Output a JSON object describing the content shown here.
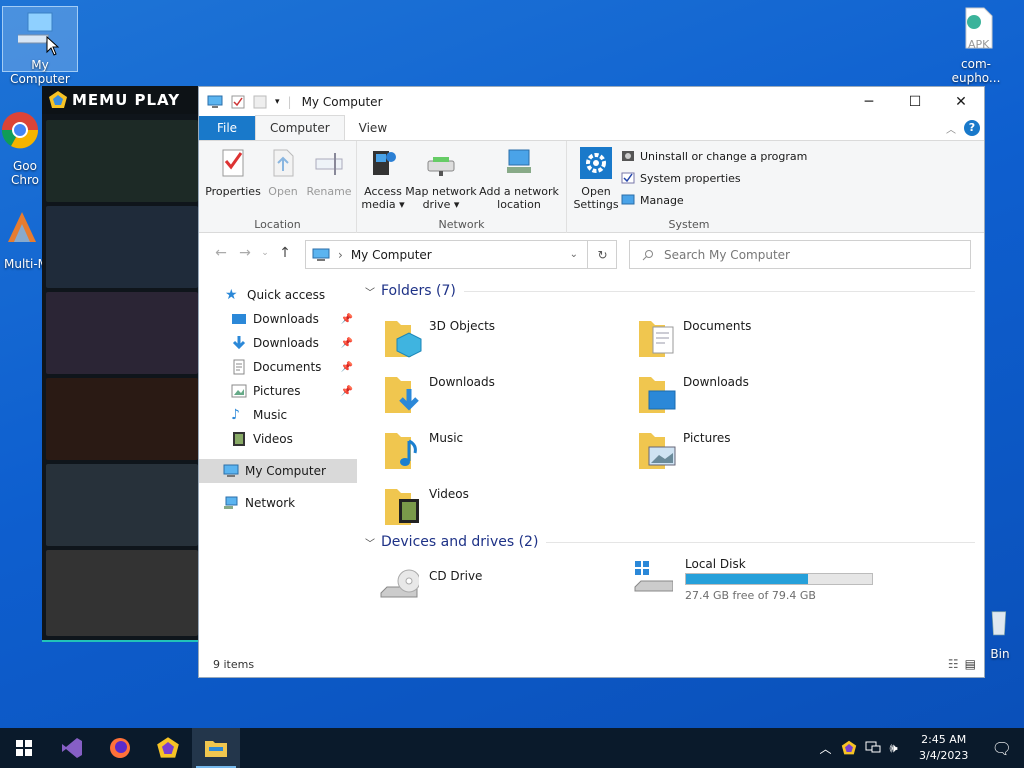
{
  "desktop": {
    "icons": [
      {
        "label": "My Computer"
      },
      {
        "label": "com-eupho..."
      },
      {
        "label": "Goo Chro"
      },
      {
        "label": "Multi-M"
      },
      {
        "label": "Bin"
      }
    ],
    "apk_badge": "APK"
  },
  "memu": {
    "title": "MEMU PLAY"
  },
  "window": {
    "title": "My Computer",
    "controls": {
      "minimize": "─",
      "maximize": "☐",
      "close": "✕"
    },
    "tabs": [
      {
        "label": "File"
      },
      {
        "label": "Computer"
      },
      {
        "label": "View"
      }
    ],
    "ribbon": {
      "location": {
        "label": "Location",
        "buttons": [
          {
            "label": "Properties"
          },
          {
            "label": "Open"
          },
          {
            "label": "Rename"
          }
        ]
      },
      "network": {
        "label": "Network",
        "buttons": [
          {
            "label": "Access media ▾"
          },
          {
            "label": "Map network drive ▾"
          },
          {
            "label": "Add a network location"
          }
        ]
      },
      "system": {
        "label": "System",
        "open_settings": "Open Settings",
        "items": [
          {
            "label": "Uninstall or change a program"
          },
          {
            "label": "System properties"
          },
          {
            "label": "Manage"
          }
        ]
      }
    },
    "address": {
      "path": "My Computer",
      "separator": "›"
    },
    "search": {
      "placeholder": "Search My Computer"
    },
    "nav": [
      {
        "label": "Quick access"
      },
      {
        "label": "Downloads"
      },
      {
        "label": "Downloads"
      },
      {
        "label": "Documents"
      },
      {
        "label": "Pictures"
      },
      {
        "label": "Music"
      },
      {
        "label": "Videos"
      },
      {
        "label": "My Computer"
      },
      {
        "label": "Network"
      }
    ],
    "folders_header": "Folders (7)",
    "folders": [
      {
        "name": "3D Objects"
      },
      {
        "name": "Documents"
      },
      {
        "name": "Downloads"
      },
      {
        "name": "Downloads"
      },
      {
        "name": "Music"
      },
      {
        "name": "Pictures"
      },
      {
        "name": "Videos"
      }
    ],
    "devices_header": "Devices and drives (2)",
    "devices": [
      {
        "name": "CD Drive"
      },
      {
        "name": "Local Disk",
        "free": "27.4 GB free of 79.4 GB",
        "used_fraction": 0.655
      }
    ],
    "status": "9 items"
  },
  "taskbar": {
    "time": "2:45 AM",
    "date": "3/4/2023"
  },
  "colors": {
    "accent": "#1979ca",
    "folder": "#f0c64f",
    "header": "#1e3287"
  }
}
